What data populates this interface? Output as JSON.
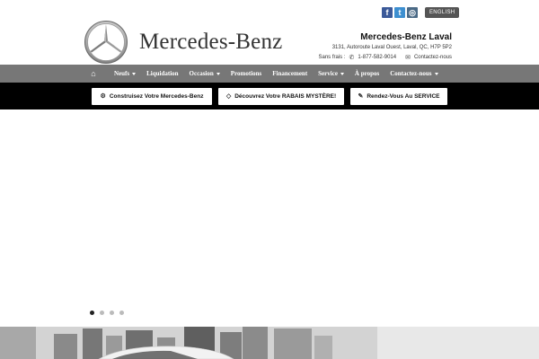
{
  "brand": {
    "wordmark": "Mercedes-Benz"
  },
  "social": {
    "facebook": "f",
    "twitter": "t",
    "instagram": "◎",
    "language_label": "ENGLISH"
  },
  "dealer": {
    "name": "Mercedes-Benz Laval",
    "address": "3131, Autoroute Laval Ouest,  Laval,  QC,  H7P 5P2",
    "tollfree_label": "Sans frais :",
    "phone": "1-877-582-9014",
    "contact_label": "Contactez-nous"
  },
  "nav": {
    "items": [
      {
        "label": "Neufs",
        "dropdown": true
      },
      {
        "label": "Liquidation",
        "dropdown": false
      },
      {
        "label": "Occasion",
        "dropdown": true
      },
      {
        "label": "Promotions",
        "dropdown": false
      },
      {
        "label": "Financement",
        "dropdown": false
      },
      {
        "label": "Service",
        "dropdown": true
      },
      {
        "label": "À propos",
        "dropdown": false
      },
      {
        "label": "Contactez-nous",
        "dropdown": true
      }
    ]
  },
  "cta": {
    "build": "Construisez Votre Mercedes-Benz",
    "rabais": "Découvrez Votre RABAIS MYSTÈRE!",
    "service": "Rendez-Vous Au SERVICE"
  },
  "slider": {
    "slide_count": 4,
    "active_index": 0
  },
  "colors": {
    "nav_bg": "#777777",
    "cta_bar_bg": "#000000",
    "fb": "#3b5998",
    "tw": "#3d8fd0"
  }
}
